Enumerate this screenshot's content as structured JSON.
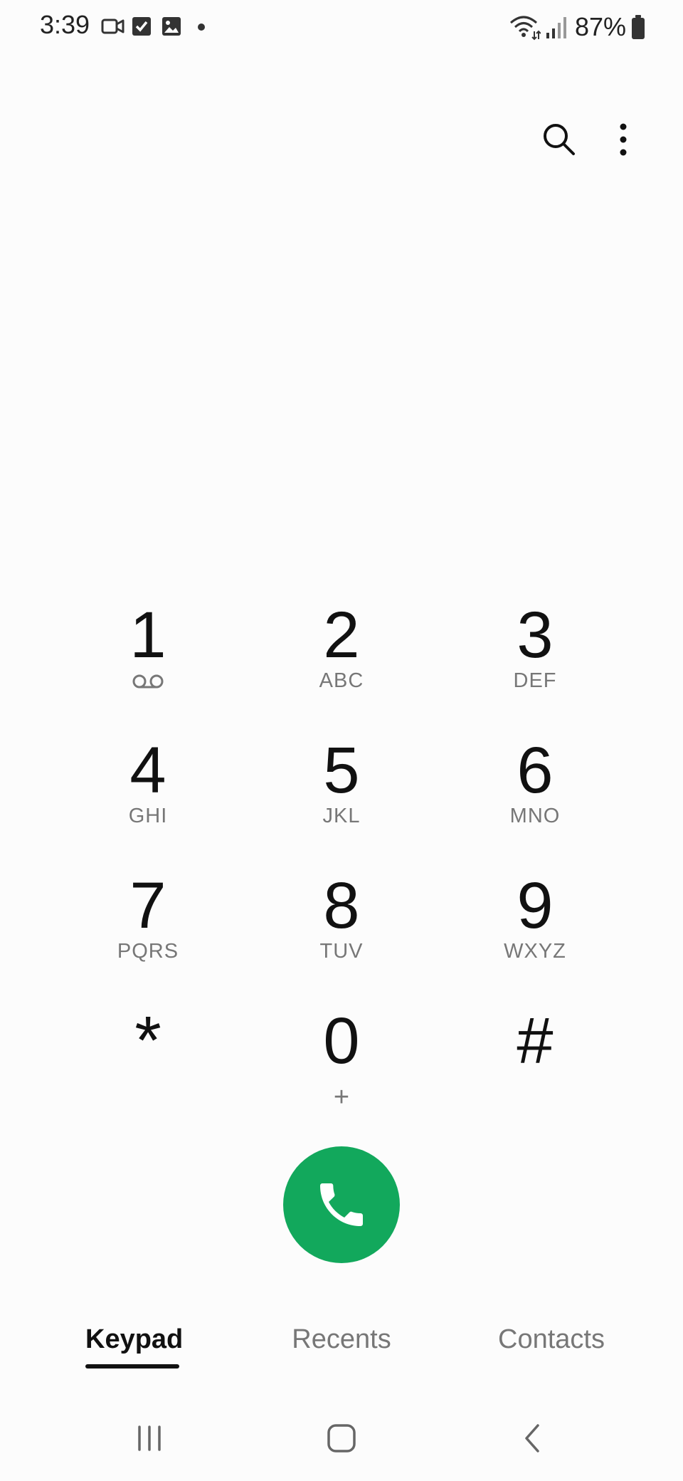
{
  "status_bar": {
    "time": "3:39",
    "battery": "87%"
  },
  "top_actions": {
    "search_icon": "search-icon",
    "more_icon": "more-vertical-icon"
  },
  "keypad": {
    "keys": [
      {
        "digit": "1",
        "letters": ""
      },
      {
        "digit": "2",
        "letters": "ABC"
      },
      {
        "digit": "3",
        "letters": "DEF"
      },
      {
        "digit": "4",
        "letters": "GHI"
      },
      {
        "digit": "5",
        "letters": "JKL"
      },
      {
        "digit": "6",
        "letters": "MNO"
      },
      {
        "digit": "7",
        "letters": "PQRS"
      },
      {
        "digit": "8",
        "letters": "TUV"
      },
      {
        "digit": "9",
        "letters": "WXYZ"
      },
      {
        "digit": "*",
        "letters": ""
      },
      {
        "digit": "0",
        "letters": "+"
      },
      {
        "digit": "#",
        "letters": ""
      }
    ]
  },
  "call_button": {
    "icon": "phone-icon",
    "color": "#12a85c"
  },
  "tabs": [
    {
      "label": "Keypad",
      "active": true
    },
    {
      "label": "Recents",
      "active": false
    },
    {
      "label": "Contacts",
      "active": false
    }
  ]
}
